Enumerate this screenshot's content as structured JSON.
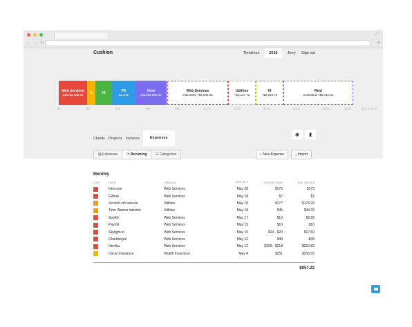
{
  "app": {
    "title": "Cushion"
  },
  "topnav": {
    "timelines": "Timelines",
    "year": "2016",
    "user": "Jerry",
    "signout": "Sign out"
  },
  "colors": {
    "web": "#e8483c",
    "utilities": "#f4b400",
    "hi": "#4bb543",
    "ps": "#2e9be6",
    "rent": "#7b6cf0",
    "orange": "#f39c12",
    "red": "#e74c3c"
  },
  "timeline": {
    "bars": [
      {
        "title": "Web Services",
        "sub": "paid $2,198.30"
      },
      {
        "title": "U",
        "sub": ""
      },
      {
        "title": "HI",
        "sub": ""
      },
      {
        "title": "PS",
        "sub": "$1,811"
      },
      {
        "title": "Rent",
        "sub": "paid $2,585.34"
      },
      {
        "title": "Web Services",
        "sub": "estimated +$4,845.43"
      },
      {
        "title": "Utilities",
        "sub": "+$2,127.72"
      },
      {
        "title": "HI",
        "sub": "+$2,288.73"
      },
      {
        "title": "Rent",
        "sub": "estimated +$5,442.01"
      }
    ],
    "ticks": [
      "$0",
      "$2k",
      "$4k",
      "$6k",
      "$8k",
      "$10k",
      "$12k",
      "$14k",
      "$16k",
      "$18k",
      "$20k",
      "$23,516.26"
    ]
  },
  "tabs": {
    "clients": "Clients",
    "projects": "Projects",
    "invoices": "Invoices",
    "expenses": "Expenses"
  },
  "toolbar": {
    "expenses": "Expenses",
    "recurring": "Recurring",
    "categories": "Categories",
    "new_expense": "New Expense",
    "import": "Import"
  },
  "table": {
    "section": "Monthly",
    "headers": {
      "color": "color",
      "name": "name",
      "category": "category",
      "next": "next on ▾",
      "range": "amount range",
      "avg": "avg. amount"
    },
    "rows": [
      {
        "name": "Intercom",
        "category": "Web Services",
        "next": "May 28",
        "range": "$175",
        "avg": "$175",
        "color": "#e8483c"
      },
      {
        "name": "Github",
        "category": "Web Services",
        "next": "May 18",
        "range": "$7",
        "avg": "$7",
        "color": "#e8483c"
      },
      {
        "name": "Verizon cell service",
        "category": "Utilities",
        "next": "May 18",
        "range": "$177",
        "avg": "$176.99",
        "color": "#f39c12"
      },
      {
        "name": "Time Warner internet",
        "category": "Utilities",
        "next": "May 18",
        "range": "$45",
        "avg": "$44.99",
        "color": "#f39c12"
      },
      {
        "name": "Spotify",
        "category": "Web Services",
        "next": "May 17",
        "range": "$10",
        "avg": "$9.99",
        "color": "#e8483c"
      },
      {
        "name": "Payroll",
        "category": "Web Services",
        "next": "May 15",
        "range": "$10",
        "avg": "$10",
        "color": "#e8483c"
      },
      {
        "name": "Skylight.io",
        "category": "Web Services",
        "next": "May 15",
        "range": "$10 - $20",
        "avg": "$17.50",
        "color": "#e8483c"
      },
      {
        "name": "Chartmogul",
        "category": "Web Services",
        "next": "May 12",
        "range": "$49",
        "avg": "$49",
        "color": "#e8483c"
      },
      {
        "name": "Heroku",
        "category": "Web Services",
        "next": "May 12",
        "range": "$209 - $218",
        "avg": "$215.82",
        "color": "#e8483c"
      },
      {
        "name": "Oscar insurance",
        "category": "Health Insurance",
        "next": "May 4",
        "range": "$251",
        "avg": "$250.93",
        "color": "#f4b400"
      }
    ],
    "total": "$957.22"
  }
}
